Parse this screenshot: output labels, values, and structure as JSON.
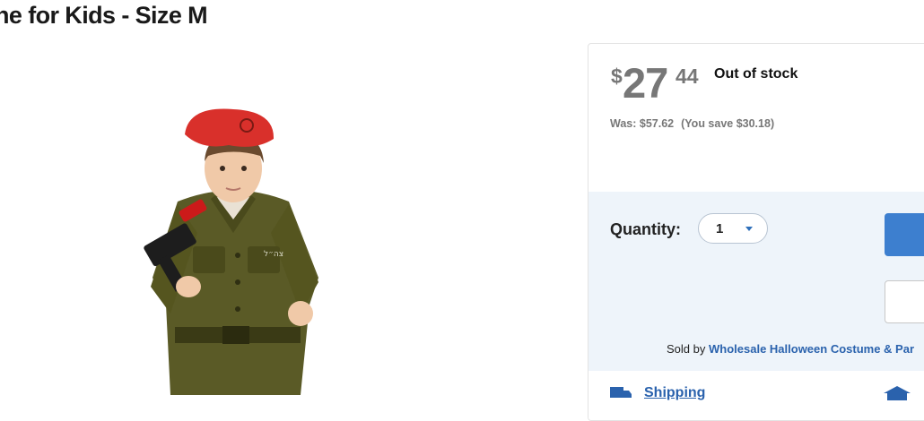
{
  "product": {
    "title": "ne for Kids - Size M"
  },
  "buybox": {
    "price": {
      "currency": "$",
      "dollars": "27",
      "cents": "44"
    },
    "stock_status": "Out of stock",
    "was_price": "Was: $57.62",
    "savings": "(You save $30.18)",
    "quantity_label": "Quantity:",
    "quantity_value": "1",
    "sold_by_prefix": "Sold by",
    "seller_name": "Wholesale Halloween Costume & Par",
    "shipping_label": "Shipping"
  },
  "colors": {
    "accent_blue": "#3d7fcf",
    "link_blue": "#2a62ad",
    "panel_bg": "#eef4fa"
  },
  "icons": [
    "truck-icon",
    "chevron-down-icon",
    "store-icon"
  ]
}
